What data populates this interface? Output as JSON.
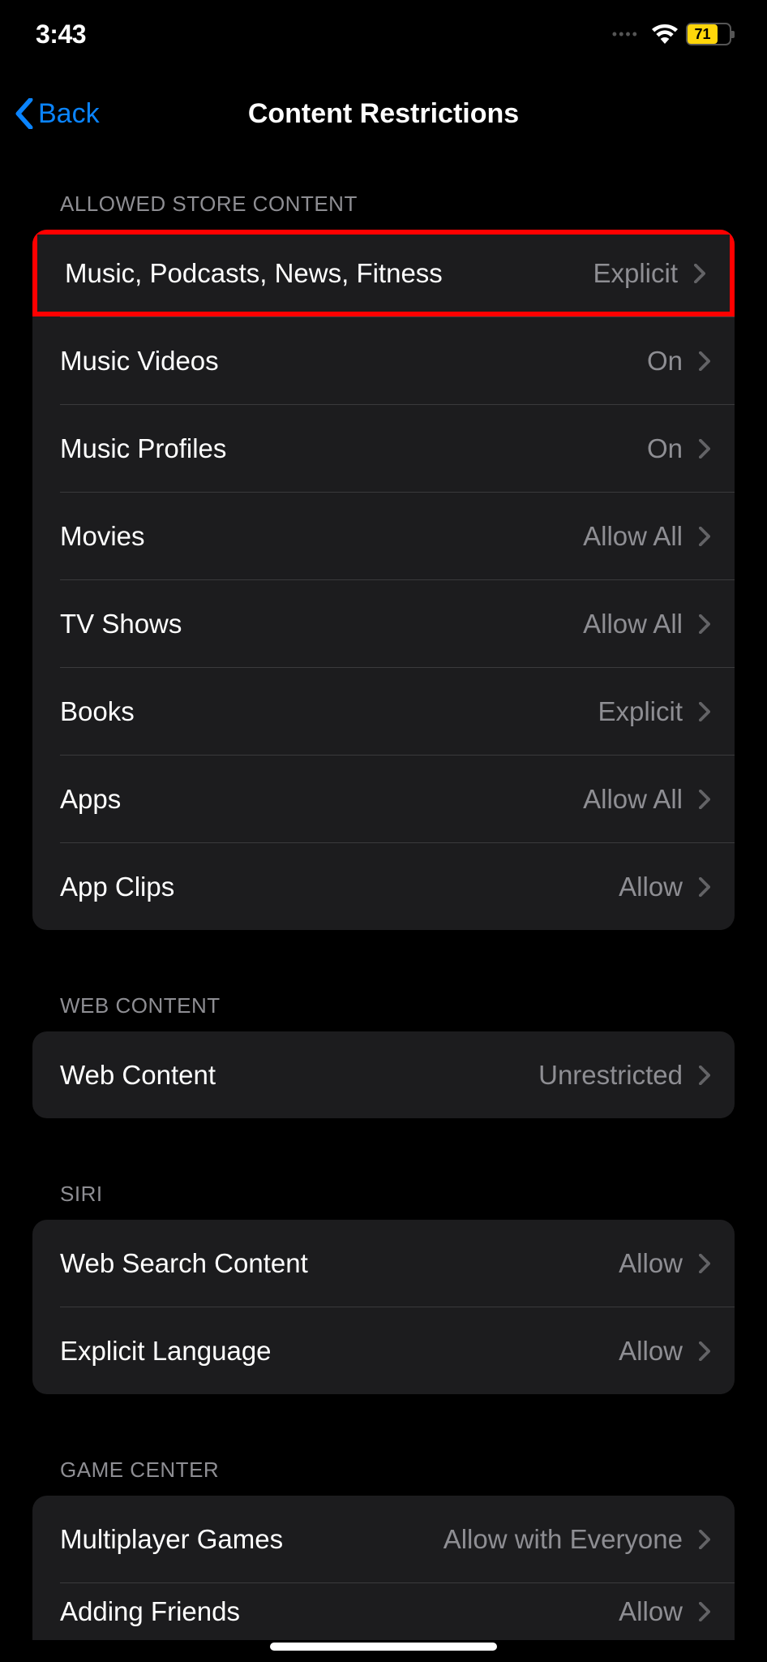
{
  "status": {
    "time": "3:43",
    "battery": "71"
  },
  "nav": {
    "back": "Back",
    "title": "Content Restrictions"
  },
  "sections": {
    "store": {
      "header": "Allowed Store Content",
      "rows": [
        {
          "label": "Music, Podcasts, News, Fitness",
          "value": "Explicit"
        },
        {
          "label": "Music Videos",
          "value": "On"
        },
        {
          "label": "Music Profiles",
          "value": "On"
        },
        {
          "label": "Movies",
          "value": "Allow All"
        },
        {
          "label": "TV Shows",
          "value": "Allow All"
        },
        {
          "label": "Books",
          "value": "Explicit"
        },
        {
          "label": "Apps",
          "value": "Allow All"
        },
        {
          "label": "App Clips",
          "value": "Allow"
        }
      ]
    },
    "web": {
      "header": "Web Content",
      "rows": [
        {
          "label": "Web Content",
          "value": "Unrestricted"
        }
      ]
    },
    "siri": {
      "header": "Siri",
      "rows": [
        {
          "label": "Web Search Content",
          "value": "Allow"
        },
        {
          "label": "Explicit Language",
          "value": "Allow"
        }
      ]
    },
    "gamecenter": {
      "header": "Game Center",
      "rows": [
        {
          "label": "Multiplayer Games",
          "value": "Allow with Everyone"
        },
        {
          "label": "Adding Friends",
          "value": "Allow"
        }
      ]
    }
  }
}
